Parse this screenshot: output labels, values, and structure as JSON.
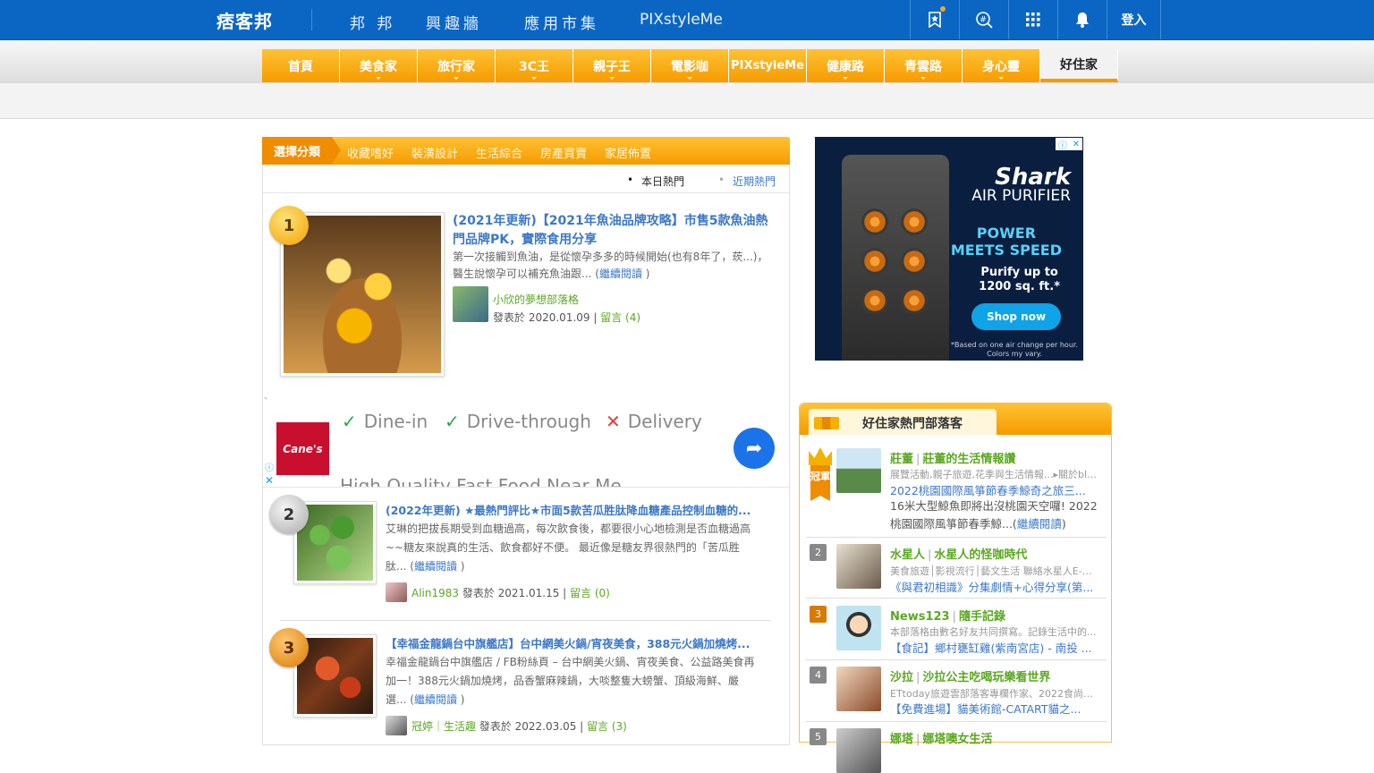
{
  "header": {
    "logo": "痞客邦",
    "nav": [
      "邦 邦",
      "興趣牆",
      "應用市集",
      "PIXstyleMe"
    ],
    "icons": [
      "bookmark-star-icon",
      "search-icon",
      "apps-grid-icon",
      "bell-icon"
    ],
    "login": "登入"
  },
  "categories": [
    "首頁",
    "美食家",
    "旅行家",
    "3C王",
    "親子王",
    "電影咖",
    "PIXstyleMe",
    "健康路",
    "青雲路",
    "身心靈",
    "好住家"
  ],
  "active_category": "好住家",
  "subnav": {
    "choose": "選擇分類",
    "items": [
      "收藏嗜好",
      "裝潢設計",
      "生活綜合",
      "房產買賣",
      "家居佈置"
    ]
  },
  "hot_tabs": [
    "本日熱門",
    "近期熱門"
  ],
  "posts": [
    {
      "rank": "1",
      "title": "(2021年更新)【2021年魚油品牌攻略】市售5款魚油熱門品牌PK，實際食用分享",
      "desc": "第一次接觸到魚油，是從懷孕多多的時候開始(也有8年了，莰...)，醫生說懷孕可以補充魚油跟... (",
      "more": "繼續閱讀",
      "close": " )",
      "author": "小欣的夢想部落格",
      "date": "發表於 2020.01.09 | ",
      "comments": "留言 (4)"
    },
    {
      "rank": "2",
      "title": "(2022年更新) ★最熱門評比★市面5款苦瓜胜肽降血糖產品控制血糖的...",
      "desc": "艾琳的把拔長期受到血糖過高，每次飲食後，都要很小心地檢測是否血糖過高~~糖友來說真的生活、飲食都好不便。 最近像是糖友界很熱門的「苦瓜胜肽... (",
      "more": "繼續閱讀",
      "close": " )",
      "author": "Alin1983",
      "date": " 發表於 2021.01.15 | ",
      "comments": "留言 (0)"
    },
    {
      "rank": "3",
      "title": "【幸福金龍鍋台中旗艦店】台中網美火鍋/宵夜美食，388元火鍋加燒烤...",
      "desc": "幸福金龍鍋台中旗艦店 / FB粉絲頁 – 台中網美火鍋、宵夜美食、公益路美食再加一！388元火鍋加燒烤，品香蟹麻辣鍋，大啖整隻大螃蟹、頂級海鮮、嚴選... (",
      "more": "繼續閱讀",
      "close": " )",
      "author": "冠婷｜生活趣",
      "date": " 發表於 2022.03.05 | ",
      "comments": "留言 (3)"
    }
  ],
  "tick_mark": "、",
  "ad_canes": {
    "logo": "Cane's",
    "features": [
      "Dine-in",
      "Drive-through",
      "Delivery"
    ],
    "headline": "High Quality Fast Food Near Me",
    "info": "ⓘ",
    "close": "✕"
  },
  "ad_shark": {
    "brand": "Shark",
    "product": "AIR PURIFIER",
    "slogan_1": "POWER",
    "slogan_2": "MEETS SPEED",
    "purify_1": "Purify up to",
    "purify_2": "1200 sq. ft.*",
    "cta": "Shop now",
    "fine_1": "*Based on one air change per hour.",
    "fine_2": "Colors my vary.",
    "adchoices": "ⓘ",
    "adclose": "✕"
  },
  "popular": {
    "title": "好住家熱門部落客",
    "crown_label": "冠軍",
    "blogs": [
      {
        "rank": "1",
        "name": "莊董",
        "blog": "莊董的生活情報讚",
        "desc": "展覽活動,親子旅遊,花季與生活情報...▸關於blog...",
        "post": "2022桃園國際風箏節春季鯨奇之旅三...",
        "snippet": "16米大型鯨魚即將出沒桃園天空囉! 2022桃園國際風箏節春季鯨...(",
        "more": "繼續閱讀",
        "close": ")"
      },
      {
        "rank": "2",
        "name": "水星人",
        "blog": "水星人的怪咖時代",
        "desc": "美食旅遊│影視流行│藝文生活 聯絡水星人E-m...",
        "post": "《與君初相識》分集劇情+心得分享(第..."
      },
      {
        "rank": "3",
        "name": "News123",
        "blog": "隨手記錄",
        "desc": "本部落格由數名好友共同撰寫。記錄生活中的...",
        "post": "【食記】鄉村甕缸雞(紫南宮店) - 南投 ..."
      },
      {
        "rank": "4",
        "name": "沙拉",
        "blog": "沙拉公主吃喝玩樂看世界",
        "desc": "ETtoday旅遊雲部落客專欄作家、2022食尚玩...",
        "post": "【免費進場】貓美術館-CATART貓之..."
      },
      {
        "rank": "5",
        "name": "娜塔",
        "blog": "娜塔噢女生活"
      }
    ]
  },
  "colors": {
    "header_blue": "#0b66c3",
    "orange": "#f59b00",
    "link_blue": "#3c78c8",
    "green": "#5aa820"
  }
}
